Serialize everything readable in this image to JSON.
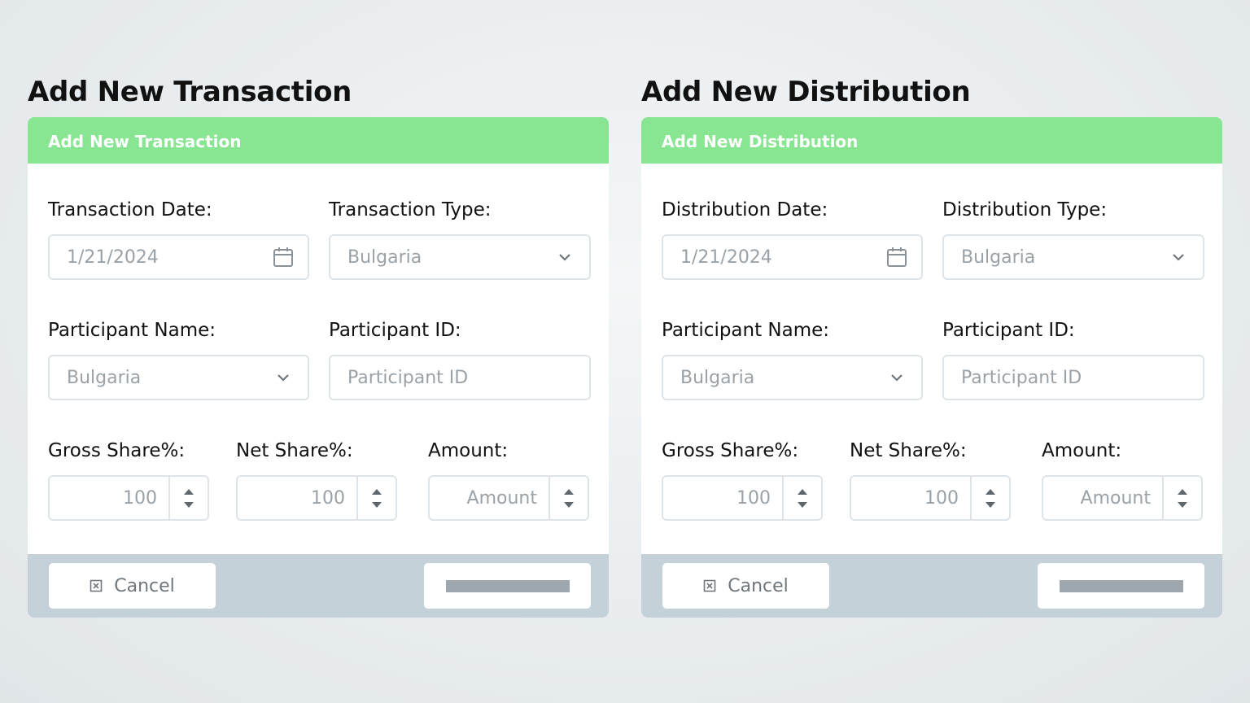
{
  "panels": [
    {
      "page_title": "Add New Transaction",
      "header": "Add New Transaction",
      "date_label": "Transaction Date:",
      "date_value": "1/21/2024",
      "type_label": "Transaction Type:",
      "type_value": "Bulgaria",
      "participant_name_label": "Participant Name:",
      "participant_name_value": "Bulgaria",
      "participant_id_label": "Participant ID:",
      "participant_id_placeholder": "Participant ID",
      "gross_share_label": "Gross Share%:",
      "gross_share_value": "100",
      "net_share_label": "Net Share%:",
      "net_share_value": "100",
      "amount_label": "Amount:",
      "amount_placeholder": "Amount",
      "cancel_label": "Cancel"
    },
    {
      "page_title": "Add New Distribution",
      "header": "Add New Distribution",
      "date_label": "Distribution Date:",
      "date_value": "1/21/2024",
      "type_label": "Distribution Type:",
      "type_value": "Bulgaria",
      "participant_name_label": "Participant Name:",
      "participant_name_value": "Bulgaria",
      "participant_id_label": "Participant ID:",
      "participant_id_placeholder": "Participant ID",
      "gross_share_label": "Gross Share%:",
      "gross_share_value": "100",
      "net_share_label": "Net Share%:",
      "net_share_value": "100",
      "amount_label": "Amount:",
      "amount_placeholder": "Amount",
      "cancel_label": "Cancel"
    }
  ],
  "icons": {
    "date": "calendar-icon",
    "dropdown": "chevron-down-icon",
    "spinner_up": "chevron-up-icon",
    "spinner_down": "chevron-down-icon",
    "cancel": "close-box-icon"
  },
  "colors": {
    "header_green": "#88e592",
    "footer_gray": "#c5d1d9",
    "border": "#dfe4e8",
    "placeholder_text": "#9aa2a8"
  }
}
